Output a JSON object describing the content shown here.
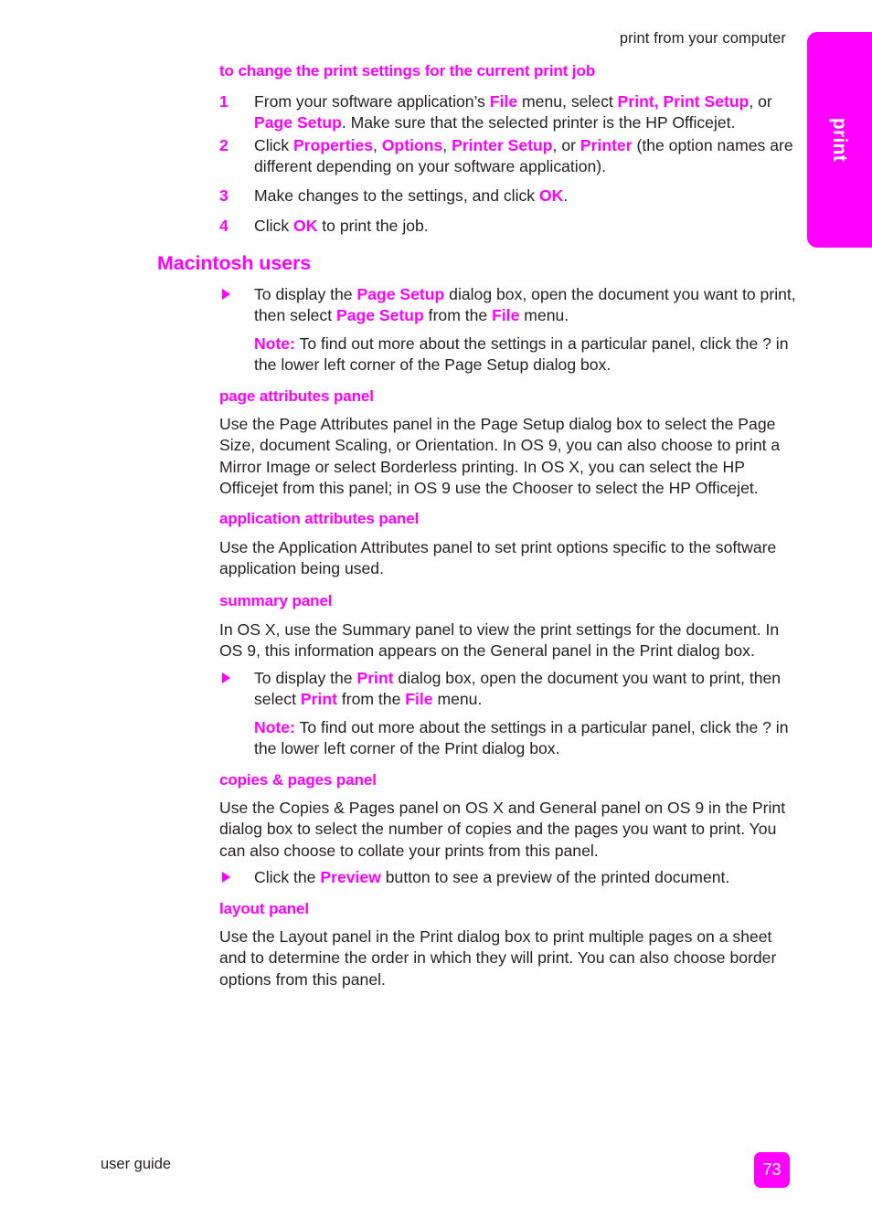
{
  "header": {
    "running_head": "print from your computer"
  },
  "side_tab": {
    "label": "print",
    "color": "#ff00ff"
  },
  "accent_color": "#ff00ff",
  "body_color": "#231f20",
  "sections": {
    "proc_heading": "to change the print settings for the current print job",
    "steps": [
      {
        "number": "1",
        "parts": [
          {
            "t": "From your software application’s ",
            "m": false
          },
          {
            "t": "File",
            "m": true
          },
          {
            "t": " menu, select ",
            "m": false
          },
          {
            "t": "Print, Print Setup",
            "m": true
          },
          {
            "t": ", or ",
            "m": false
          },
          {
            "t": "Page Setup",
            "m": true
          },
          {
            "t": ". Make sure that the selected printer is the HP Officejet.",
            "m": false
          }
        ]
      },
      {
        "number": "2",
        "parts": [
          {
            "t": "Click ",
            "m": false
          },
          {
            "t": "Properties",
            "m": true
          },
          {
            "t": ", ",
            "m": false
          },
          {
            "t": "Options",
            "m": true
          },
          {
            "t": ", ",
            "m": false
          },
          {
            "t": "Printer Setup",
            "m": true
          },
          {
            "t": ", or ",
            "m": false
          },
          {
            "t": "Printer",
            "m": true
          },
          {
            "t": " (the option names are different depending on your software application).",
            "m": false
          }
        ]
      },
      {
        "number": "3",
        "parts": [
          {
            "t": "Make changes to the settings, and click ",
            "m": false
          },
          {
            "t": "OK",
            "m": true
          },
          {
            "t": ".",
            "m": false
          }
        ]
      },
      {
        "number": "4",
        "parts": [
          {
            "t": "Click ",
            "m": false
          },
          {
            "t": "OK",
            "m": true
          },
          {
            "t": " to print the job.",
            "m": false
          }
        ]
      }
    ],
    "macintosh_heading": "Macintosh users",
    "mac_bullet": [
      {
        "t": "To display the ",
        "m": false
      },
      {
        "t": "Page Setup",
        "m": true
      },
      {
        "t": " dialog box, open the document you want to print, then select ",
        "m": false
      },
      {
        "t": "Page Setup",
        "m": true
      },
      {
        "t": " from the ",
        "m": false
      },
      {
        "t": "File",
        "m": true
      },
      {
        "t": " menu.",
        "m": false
      }
    ],
    "mac_note": [
      {
        "t": "Note:",
        "m": true
      },
      {
        "t": "  To find out more about the settings in a particular panel, click the ? in the lower left corner of the Page Setup dialog box.",
        "m": false
      }
    ],
    "page_attributes_heading": "page attributes panel",
    "page_attributes_body": "Use the Page Attributes panel in the Page Setup dialog box to select the Page Size, document Scaling, or Orientation. In OS 9, you can also choose to print a Mirror Image or select Borderless printing. In OS X, you can select the HP Officejet from this panel; in OS 9 use the Chooser to select the HP Officejet.",
    "application_attributes_heading": "application attributes panel",
    "application_attributes_body": "Use the Application Attributes panel to set print options specific to the software application being used.",
    "summary_heading": "summary panel",
    "summary_body": "In OS X, use the Summary panel to view the print settings for the document. In OS 9, this information appears on the General panel in the Print dialog box.",
    "print_bullet": [
      {
        "t": "To display the ",
        "m": false
      },
      {
        "t": "Print",
        "m": true
      },
      {
        "t": " dialog box, open the document you want to print, then select ",
        "m": false
      },
      {
        "t": "Print",
        "m": true
      },
      {
        "t": " from the ",
        "m": false
      },
      {
        "t": "File",
        "m": true
      },
      {
        "t": " menu.",
        "m": false
      }
    ],
    "print_note": [
      {
        "t": "Note:",
        "m": true
      },
      {
        "t": "  To find out more about the settings in a particular panel, click the ? in the lower left corner of the Print dialog box.",
        "m": false
      }
    ],
    "copies_heading": "copies & pages panel",
    "copies_body": "Use the Copies & Pages panel on OS X and General panel on OS 9 in the Print dialog box to select the number of copies and the pages you want to print. You can also choose to collate your prints from this panel.",
    "preview_bullet": [
      {
        "t": "Click the ",
        "m": false
      },
      {
        "t": "Preview",
        "m": true
      },
      {
        "t": " button to see a preview of the printed document.",
        "m": false
      }
    ],
    "layout_heading": "layout panel",
    "layout_body": "Use the Layout panel in the Print dialog box to print multiple pages on a sheet and to determine the order in which they will print. You can also choose border options from this panel."
  },
  "footer": {
    "left_label": "user guide",
    "page_number": "73"
  }
}
